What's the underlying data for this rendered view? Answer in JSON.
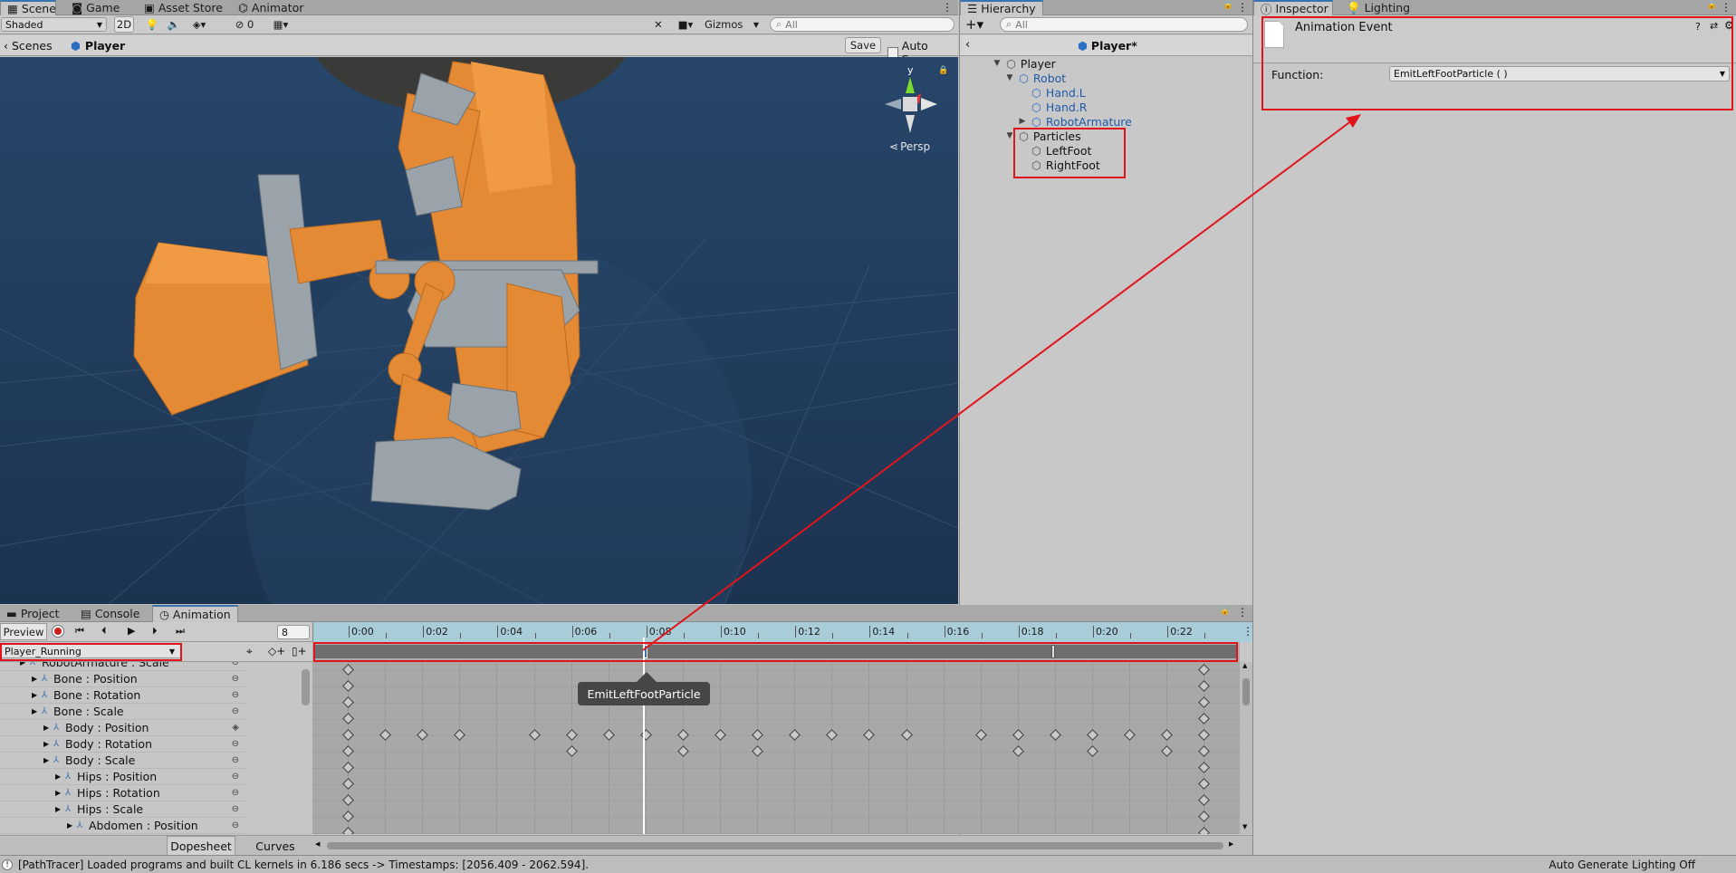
{
  "scene_panel": {
    "tabs": [
      "Scene",
      "Game",
      "Asset Store",
      "Animator"
    ],
    "shading_mode": "Shaded",
    "mode_2d": "2D",
    "hidden_count": "0",
    "gizmos_label": "Gizmos",
    "search_placeholder": "All",
    "breadcrumb_root": "Scenes",
    "breadcrumb_current": "Player",
    "save_label": "Save",
    "auto_save_label": "Auto Save",
    "auto_save_checked": false,
    "persp_label": "Persp",
    "gizmo_axis_label": "y"
  },
  "hierarchy": {
    "tab": "Hierarchy",
    "search_placeholder": "All",
    "prefab_title": "Player*",
    "items": [
      {
        "label": "Player",
        "depth": 0,
        "expanded": true,
        "blue": false
      },
      {
        "label": "Robot",
        "depth": 1,
        "expanded": true,
        "blue": true
      },
      {
        "label": "Hand.L",
        "depth": 2,
        "expanded": null,
        "blue": true
      },
      {
        "label": "Hand.R",
        "depth": 2,
        "expanded": null,
        "blue": true
      },
      {
        "label": "RobotArmature",
        "depth": 2,
        "expanded": false,
        "blue": true
      },
      {
        "label": "Particles",
        "depth": 1,
        "expanded": true,
        "blue": false
      },
      {
        "label": "LeftFoot",
        "depth": 2,
        "expanded": null,
        "blue": false
      },
      {
        "label": "RightFoot",
        "depth": 2,
        "expanded": null,
        "blue": false
      }
    ]
  },
  "inspector": {
    "tabs": [
      "Inspector",
      "Lighting"
    ],
    "title": "Animation Event",
    "function_label": "Function:",
    "function_value": "EmitLeftFootParticle ( )"
  },
  "bottom_panel": {
    "tabs": [
      "Project",
      "Console",
      "Animation"
    ],
    "preview_label": "Preview",
    "frame_value": "8",
    "clip_name": "Player_Running",
    "properties": [
      {
        "label": "RobotArmature : Scale",
        "depth": 0
      },
      {
        "label": "Bone : Position",
        "depth": 1
      },
      {
        "label": "Bone : Rotation",
        "depth": 1
      },
      {
        "label": "Bone : Scale",
        "depth": 1
      },
      {
        "label": "Body : Position",
        "depth": 2
      },
      {
        "label": "Body : Rotation",
        "depth": 2
      },
      {
        "label": "Body : Scale",
        "depth": 2
      },
      {
        "label": "Hips : Position",
        "depth": 3
      },
      {
        "label": "Hips : Rotation",
        "depth": 3
      },
      {
        "label": "Hips : Scale",
        "depth": 3
      },
      {
        "label": "Abdomen : Position",
        "depth": 4
      }
    ],
    "view_tabs": [
      "Dopesheet",
      "Curves"
    ],
    "timeline_ticks": [
      "0:00",
      "0:02",
      "0:04",
      "0:06",
      "0:08",
      "0:10",
      "0:12",
      "0:14",
      "0:16",
      "0:18",
      "0:20",
      "0:22"
    ],
    "event_tooltip": "EmitLeftFootParticle"
  },
  "status_bar": {
    "message": "[PathTracer] Loaded programs and built CL kernels in 6.186 secs -> Timestamps: [2056.409 - 2062.594].",
    "right_text": "Auto Generate Lighting Off"
  },
  "colors": {
    "accent": "#3a72b0",
    "highlight_box": "#e1141b",
    "scene_bg": "#1f3a57",
    "robot_orange": "#e58a34"
  }
}
